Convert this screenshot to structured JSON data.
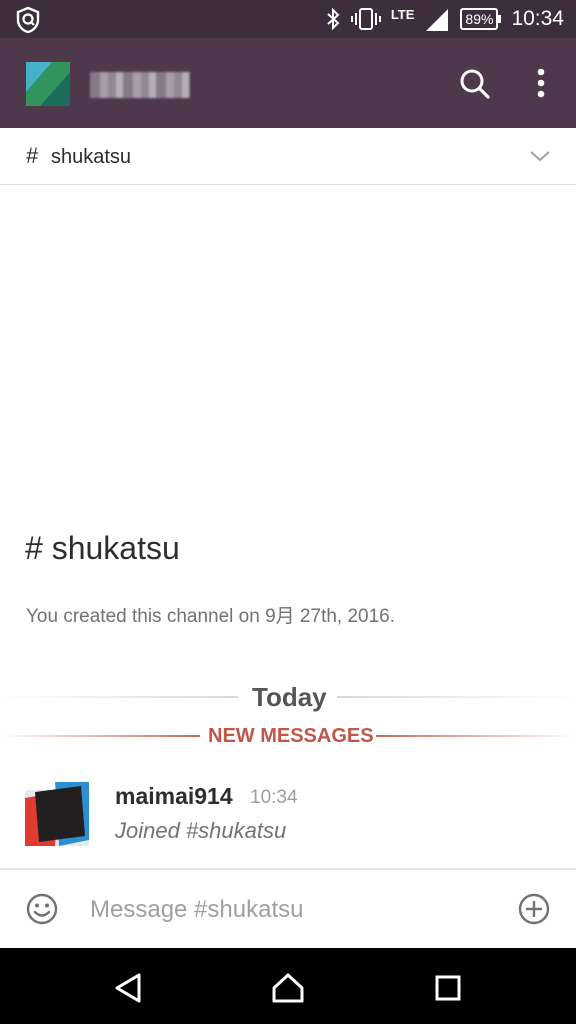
{
  "status_bar": {
    "network": "LTE",
    "battery": "89%",
    "time": "10:34"
  },
  "app_bar": {
    "team_logo_icon": "slack-team-logo",
    "search_icon": "search-icon",
    "overflow_icon": "more-vert-icon"
  },
  "channel_header": {
    "hash": "#",
    "name": "shukatsu",
    "chevron_icon": "chevron-down-icon"
  },
  "intro": {
    "title": "# shukatsu",
    "subtitle": "You created this channel on 9月 27th, 2016."
  },
  "dividers": {
    "today": "Today",
    "new_messages": "NEW MESSAGES"
  },
  "messages": [
    {
      "author": "maimai914",
      "time": "10:34",
      "text": "Joined #shukatsu"
    }
  ],
  "composer": {
    "placeholder": "Message #shukatsu",
    "emoji_icon": "emoji-icon",
    "attach_icon": "add-circle-icon"
  },
  "nav_bar": {
    "back_icon": "back-triangle-icon",
    "home_icon": "home-icon",
    "recents_icon": "recents-square-icon"
  },
  "colors": {
    "status_bar": "#3c2e3d",
    "app_bar": "#4d394b",
    "new_messages": "#c1574a"
  }
}
